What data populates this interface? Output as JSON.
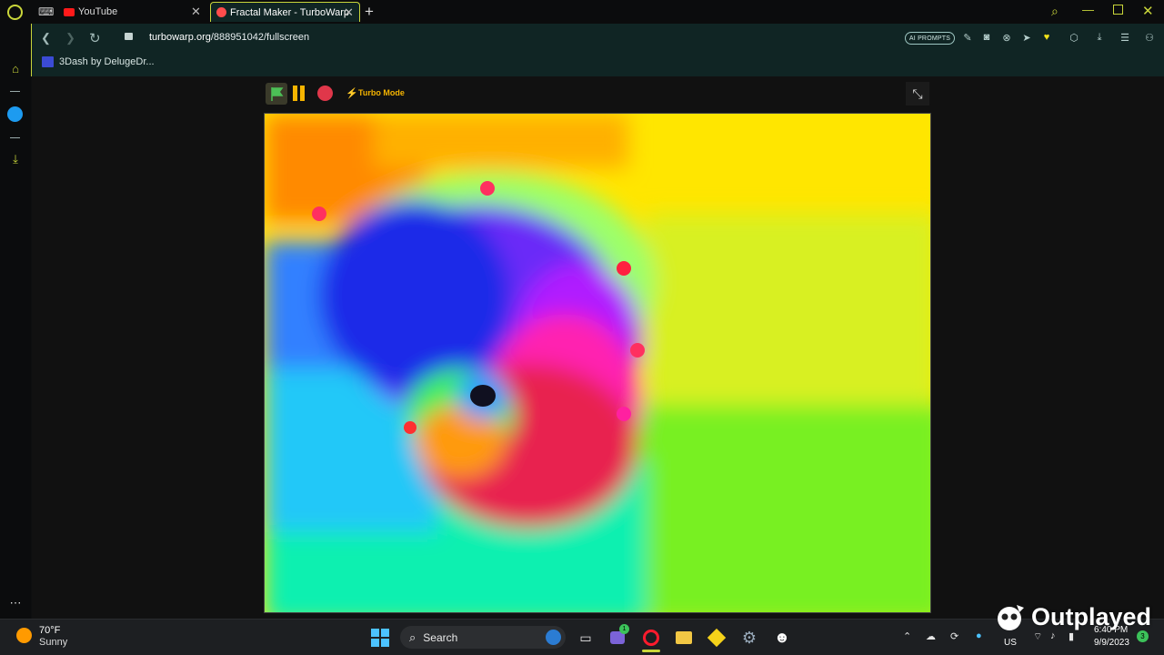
{
  "browser": {
    "tabs": [
      {
        "label": "YouTube",
        "active": false
      },
      {
        "label": "Fractal Maker - TurboWarp",
        "active": true
      }
    ],
    "new_tab_symbol": "+",
    "url_host": "turbowarp.org",
    "url_path": "/888951042/fullscreen",
    "ai_badge": "AI PROMPTS",
    "bookmark": "3Dash by DelugeDr...",
    "accent_color": "#c9d63a",
    "icons": [
      "opera-logo-icon",
      "gamepad-icon",
      "back-icon",
      "forward-icon",
      "reload-icon",
      "lock-icon",
      "search-icon",
      "minimize-icon",
      "restore-icon",
      "close-icon"
    ]
  },
  "player": {
    "turbo_label": "Turbo Mode",
    "controls": [
      "green-flag-icon",
      "pause-icon",
      "stop-icon",
      "lightning-icon",
      "exit-fullscreen-icon"
    ]
  },
  "taskbar": {
    "weather_temp": "70°F",
    "weather_desc": "Sunny",
    "search_label": "Search",
    "language": "US",
    "time": "6:40 PM",
    "date": "9/9/2023",
    "notification_count": "3",
    "teams_badge": "1"
  },
  "watermark": "Outplayed"
}
